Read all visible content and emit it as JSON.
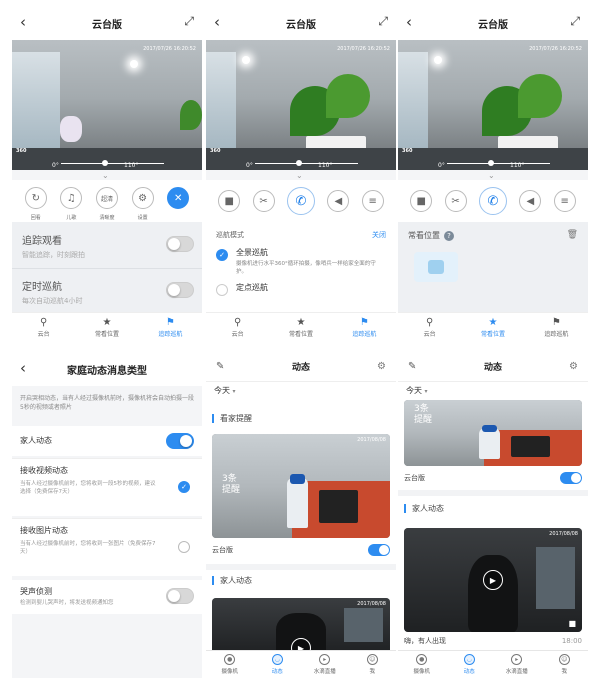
{
  "ptz": {
    "title": "云台版",
    "timestamp": "2017/07/26 16:20:52",
    "watermark": "360",
    "angle_start": "0°",
    "angle_end": "110°",
    "controls": [
      {
        "icon": "rotate-icon",
        "label": "回看"
      },
      {
        "icon": "music-icon",
        "label": "儿歌"
      },
      {
        "icon": "hd-icon",
        "label": "清晰度",
        "glyph": "超清"
      },
      {
        "icon": "gear-icon",
        "label": "设置"
      }
    ],
    "track": {
      "title": "追踪观看",
      "subtitle": "智能追踪，时刻跟拍",
      "on": false
    },
    "timed": {
      "title": "定时巡航",
      "subtitle": "每次自动巡航4小时",
      "on": false
    },
    "tabs": [
      "云台",
      "常看位置",
      "追踪巡航"
    ],
    "cruise": {
      "mode_label": "巡航模式",
      "close_label": "关闭",
      "items": [
        {
          "title": "全景巡航",
          "desc": "摄像机进行水平360°循环拍摄，像哨兵一样给家全面的守护。",
          "checked": true
        },
        {
          "title": "定点巡航",
          "desc": "",
          "checked": false
        }
      ]
    },
    "favorites": {
      "title": "常看位置",
      "help": "?"
    }
  },
  "settings": {
    "title": "家庭动态消息类型",
    "intro": "开启哭相动态，当有人经过摄像机前时，摄像机将会自动拍摄一段5秒的视频或者照片",
    "family": {
      "label": "家人动态",
      "on": true
    },
    "video": {
      "title": "接收视频动态",
      "desc": "当有人经过摄像机前时，您将收到一段5秒的视频，建议选择（免费保存7天）",
      "checked": true
    },
    "photo": {
      "title": "接收图片动态",
      "desc": "当有人经过摄像机前时，您将收到一张图片（免费保存7天）",
      "checked": false
    },
    "cry": {
      "title": "哭声侦测",
      "desc": "检测到婴儿哭声时，将发送视频通知您",
      "on": false
    }
  },
  "feed": {
    "title": "动态",
    "today": "今天",
    "section_watch": "看家提醒",
    "section_family": "家人动态",
    "count_line1": "3条",
    "count_line2": "提醒",
    "device": "云台版",
    "card_time": "2017/08/08",
    "event_text": "嗨，有人出现",
    "event_time": "18:00",
    "tabs": [
      "摄像机",
      "动态",
      "水滴直播",
      "我"
    ]
  }
}
